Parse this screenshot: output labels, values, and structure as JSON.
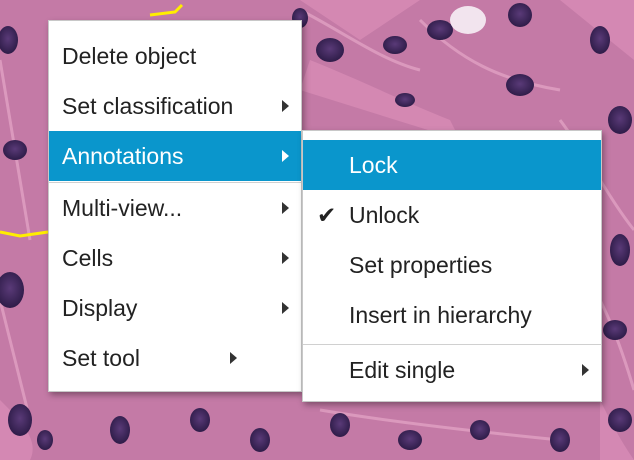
{
  "main_menu": {
    "items": [
      {
        "label": "Delete object"
      },
      {
        "label": "Set classification"
      },
      {
        "label": "Annotations"
      },
      {
        "label": "Multi-view..."
      },
      {
        "label": "Cells"
      },
      {
        "label": "Display"
      },
      {
        "label": "Set tool"
      }
    ]
  },
  "submenu": {
    "items": [
      {
        "label": "Lock"
      },
      {
        "label": "Unlock",
        "checked": true
      },
      {
        "label": "Set properties"
      },
      {
        "label": "Insert in hierarchy"
      },
      {
        "label": "Edit single"
      }
    ],
    "check_glyph": "✔"
  },
  "colors": {
    "highlight": "#0a96cc",
    "annotation_outline": "#ffee00"
  }
}
